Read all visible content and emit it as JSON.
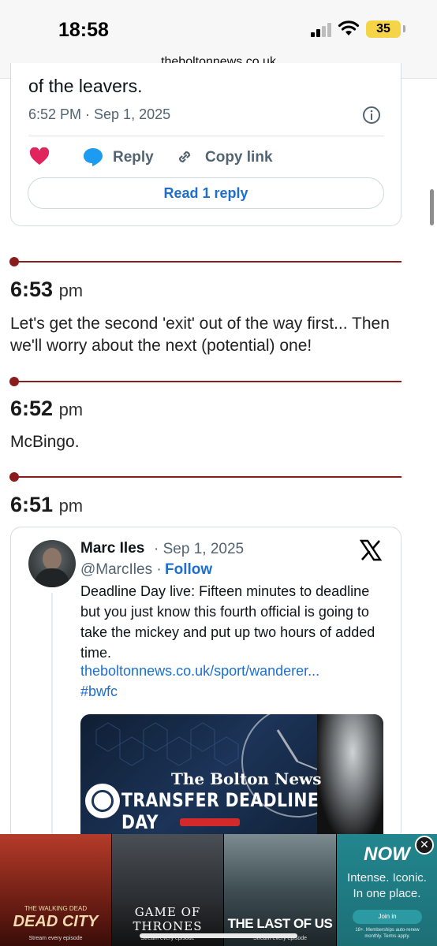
{
  "status_bar": {
    "time": "18:58",
    "battery": "35",
    "url": "theboltonnews.co.uk"
  },
  "top_tweet": {
    "text_end": "of the leavers.",
    "timestamp": "6:52 PM · Sep 1, 2025",
    "reply_label": "Reply",
    "copy_link_label": "Copy link",
    "read_replies_label": "Read 1 reply",
    "icons": [
      "info-icon",
      "heart-icon",
      "reply-bubble-icon",
      "link-icon"
    ]
  },
  "entries": [
    {
      "time": "6:53",
      "ampm": "pm",
      "text": "Let's get the second 'exit' out of the way first... Then we'll worry about the next (potential) one!"
    },
    {
      "time": "6:52",
      "ampm": "pm",
      "text": "McBingo."
    },
    {
      "time": "6:51",
      "ampm": "pm"
    }
  ],
  "embed": {
    "author_name": "Marc Iles",
    "date": "· Sep 1, 2025",
    "handle": "@MarcIles ·",
    "follow_label": "Follow",
    "text": "Deadline Day live: Fifteen minutes to deadline but you just know this fourth official is going to take the mickey and put up two hours of added time.",
    "link": "theboltonnews.co.uk/sport/wanderer...",
    "hashtag": "#bwfc",
    "image": {
      "brand": "The Bolton News",
      "title": "TRANSFER DEADLINE DAY"
    }
  },
  "ad": {
    "tiles": [
      {
        "small": "THE WALKING DEAD",
        "title": "DEAD CITY",
        "sub": "Stream every episode"
      },
      {
        "title": "GAME OF THRONES",
        "sub": "Stream every episode"
      },
      {
        "title": "THE LAST OF US",
        "sub": "Stream every episode"
      }
    ],
    "brand": "NOW",
    "tagline_1": "Intense. Iconic.",
    "tagline_2": "In one place.",
    "join_label": "Join in",
    "terms": "18+. Memberships auto-renew monthly. Terms apply.",
    "close_glyph": "✕"
  },
  "colors": {
    "accent_link": "#1d6fcf",
    "entry_rule": "#8b1c1c",
    "heart": "#e0245e",
    "reply_blue": "#1d9bf0"
  }
}
